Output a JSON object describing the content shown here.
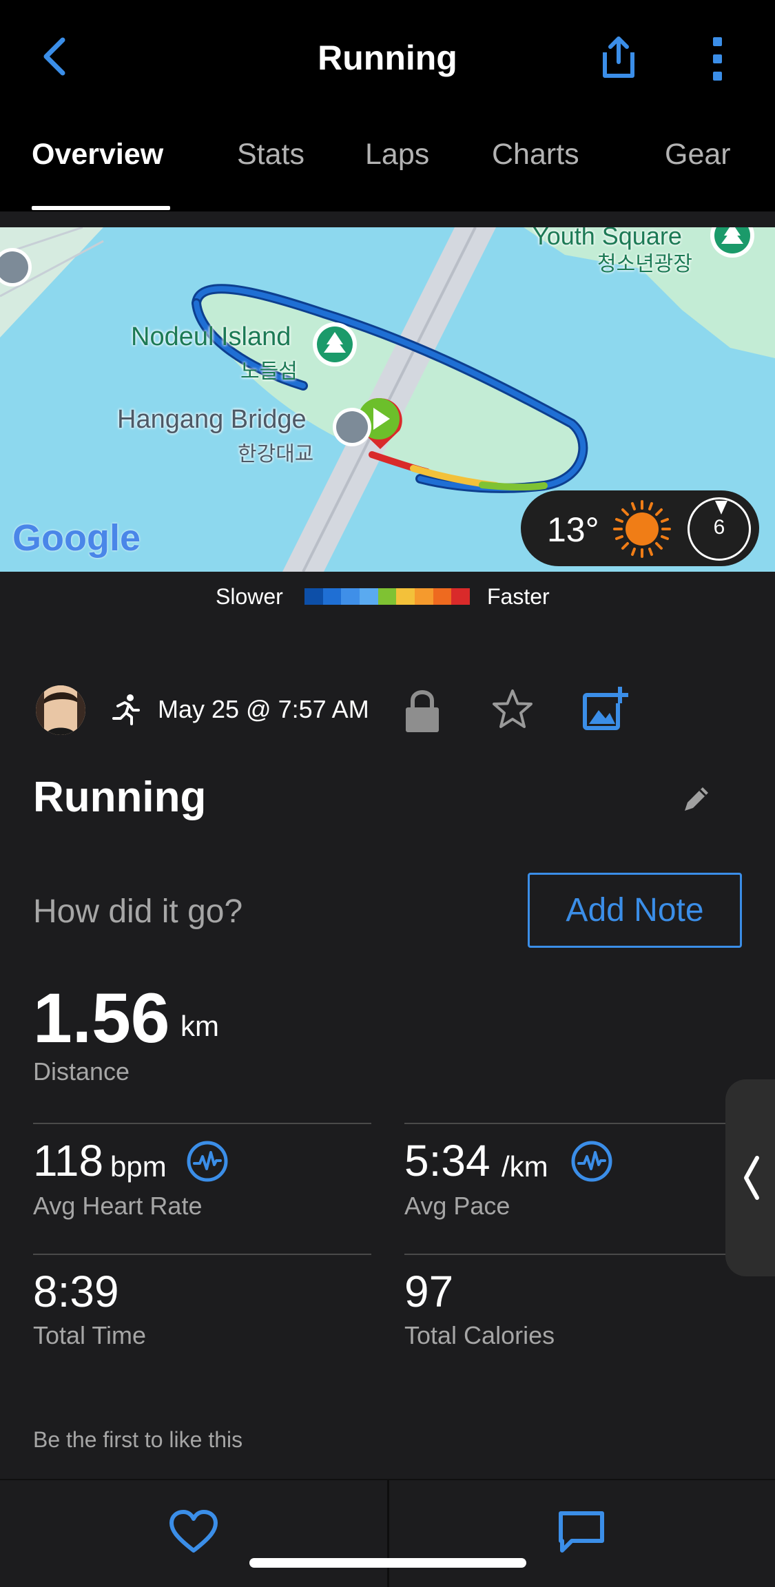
{
  "nav": {
    "title": "Running"
  },
  "tabs": [
    {
      "label": "Overview",
      "active": true
    },
    {
      "label": "Stats",
      "active": false
    },
    {
      "label": "Laps",
      "active": false
    },
    {
      "label": "Charts",
      "active": false
    },
    {
      "label": "Gear",
      "active": false
    }
  ],
  "map": {
    "places": [
      {
        "name": "Youth Square",
        "name_local": "청소년광장"
      },
      {
        "name": "Nodeul Island",
        "name_local": "노들섬"
      },
      {
        "name": "Hangang Bridge",
        "name_local": "한강대교"
      }
    ],
    "attribution": "Google",
    "weather": {
      "temperature": "13°",
      "condition_icon": "sun-icon",
      "wind_speed": "6"
    }
  },
  "pace_legend": {
    "slower_label": "Slower",
    "faster_label": "Faster",
    "colors": [
      "#0d4fa8",
      "#1f6fd4",
      "#3f8fe8",
      "#5aaaf0",
      "#7fc233",
      "#f3c13a",
      "#f59a2d",
      "#ee6a1f",
      "#d92a2a"
    ]
  },
  "activity": {
    "date": "May 25 @ 7:57 AM",
    "title": "Running",
    "prompt": "How did it go?",
    "add_note_label": "Add Note"
  },
  "stats": {
    "distance": {
      "value": "1.56",
      "unit": "km",
      "label": "Distance"
    },
    "avg_heart_rate": {
      "value": "118",
      "unit": "bpm",
      "label": "Avg Heart Rate"
    },
    "avg_pace": {
      "value": "5:34",
      "unit": "/km",
      "label": "Avg Pace"
    },
    "total_time": {
      "value": "8:39",
      "label": "Total Time"
    },
    "total_calories": {
      "value": "97",
      "label": "Total Calories"
    }
  },
  "social": {
    "like_prompt": "Be the first to like this"
  },
  "colors": {
    "accent": "#3b8ee8",
    "background": "#1c1c1e",
    "header": "#000000",
    "water": "#8dd8ee",
    "park": "#c3ecd5"
  }
}
